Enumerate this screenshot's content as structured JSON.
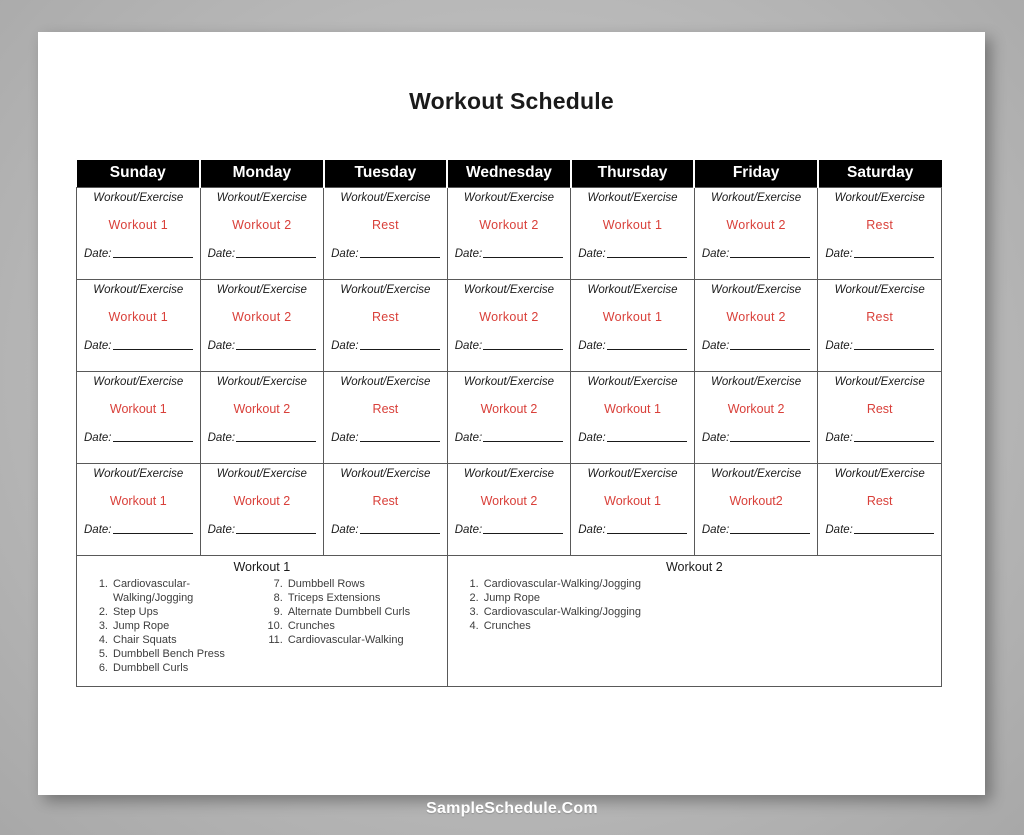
{
  "document": {
    "title": "Workout Schedule"
  },
  "schedule": {
    "days": [
      "Sunday",
      "Monday",
      "Tuesday",
      "Wednesday",
      "Thursday",
      "Friday",
      "Saturday"
    ],
    "cell_label": "Workout/Exercise",
    "date_label": "Date:",
    "accent_color": "#d9403a",
    "header_background": "#000000",
    "rows": [
      {
        "values": [
          "Workout 1",
          "Workout 2",
          "Rest",
          "Workout 2",
          "Workout 1",
          "Workout 2",
          "Rest"
        ]
      },
      {
        "values": [
          "Workout 1",
          "Workout 2",
          "Rest",
          "Workout 2",
          "Workout 1",
          "Workout 2",
          "Rest"
        ]
      },
      {
        "values": [
          "Workout 1",
          "Workout 2",
          "Rest",
          "Workout 2",
          "Workout 1",
          "Workout 2",
          "Rest"
        ]
      },
      {
        "values": [
          "Workout 1",
          "Workout 2",
          "Rest",
          "Workout 2",
          "Workout 1",
          "Workout2",
          "Rest"
        ]
      }
    ]
  },
  "legend": {
    "workout_1": {
      "title": "Workout 1",
      "column_left": [
        {
          "num": "1.",
          "text": "Cardiovascular-Walking/Jogging"
        },
        {
          "num": "2.",
          "text": "Step Ups"
        },
        {
          "num": "3.",
          "text": "Jump Rope"
        },
        {
          "num": "4.",
          "text": "Chair Squats"
        },
        {
          "num": "5.",
          "text": "Dumbbell Bench Press"
        },
        {
          "num": "6.",
          "text": "Dumbbell Curls"
        }
      ],
      "column_right": [
        {
          "num": "7.",
          "text": "Dumbbell Rows"
        },
        {
          "num": "8.",
          "text": "Triceps Extensions"
        },
        {
          "num": "9.",
          "text": "Alternate Dumbbell Curls"
        },
        {
          "num": "10.",
          "text": "Crunches"
        },
        {
          "num": "11.",
          "text": "Cardiovascular-Walking"
        }
      ]
    },
    "workout_2": {
      "title": "Workout 2",
      "items": [
        {
          "num": "1.",
          "text": "Cardiovascular-Walking/Jogging"
        },
        {
          "num": "2.",
          "text": "Jump Rope"
        },
        {
          "num": "3.",
          "text": "Cardiovascular-Walking/Jogging"
        },
        {
          "num": "4.",
          "text": "Crunches"
        }
      ]
    }
  },
  "footer": {
    "brand": "SampleSchedule.Com"
  }
}
